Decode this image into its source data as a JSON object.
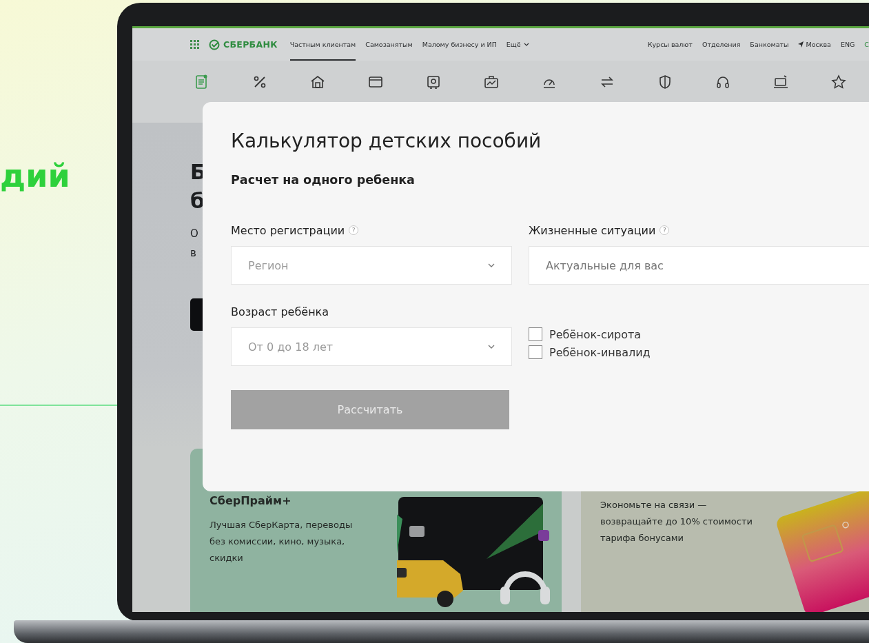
{
  "promo_text": "дий",
  "header": {
    "logo": "СБЕРБАНК",
    "nav": [
      {
        "label": "Частным клиентам",
        "selected": true
      },
      {
        "label": "Самозанятым",
        "selected": false
      },
      {
        "label": "Малому бизнесу и ИП",
        "selected": false
      },
      {
        "label": "Ещё",
        "selected": false,
        "dropdown": true
      }
    ],
    "links": [
      {
        "label": "Курсы валют"
      },
      {
        "label": "Отделения"
      },
      {
        "label": "Банкоматы"
      },
      {
        "label": "Москва",
        "kind": "location"
      },
      {
        "label": "ENG"
      },
      {
        "label": "С",
        "kind": "accent"
      }
    ]
  },
  "categories": [
    {
      "kind": "doc"
    },
    {
      "kind": "percent"
    },
    {
      "kind": "house"
    },
    {
      "kind": "card"
    },
    {
      "kind": "safe"
    },
    {
      "kind": "portfolio"
    },
    {
      "kind": "gauge"
    },
    {
      "kind": "arrows"
    },
    {
      "kind": "shield"
    },
    {
      "kind": "headset"
    },
    {
      "kind": "device"
    },
    {
      "kind": "star"
    }
  ],
  "hero": {
    "heading": [
      "Б",
      "б"
    ],
    "text": [
      "О",
      "в"
    ]
  },
  "modal": {
    "title": "Калькулятор детских пособий",
    "subtitle": "Расчет на одного ребенка",
    "fields": [
      {
        "label": "Место регистрации",
        "help": "?",
        "kind": "select",
        "placeholder": "Регион"
      },
      {
        "label": "Жизненные ситуации",
        "help": "?",
        "kind": "input",
        "placeholder": "Актуальные для вас"
      },
      {
        "label": "Возраст ребёнка",
        "kind": "select",
        "placeholder": "От 0 до 18 лет"
      }
    ],
    "checkboxes": [
      {
        "label": "Ребёнок-сирота",
        "checked": false
      },
      {
        "label": "Ребёнок-инвалид",
        "checked": false
      }
    ],
    "button": {
      "label": "Рассчитать",
      "disabled": true
    }
  },
  "cards": [
    {
      "title": "СберПрайм+",
      "text": "Лучшая СберКарта, переводы без комиссии, кино, музыка, скидки",
      "kind": "prime"
    },
    {
      "text": "Экономьте на связи — возвращайте до 10% стоимости тарифа бонусами",
      "kind": "mobile"
    }
  ]
}
